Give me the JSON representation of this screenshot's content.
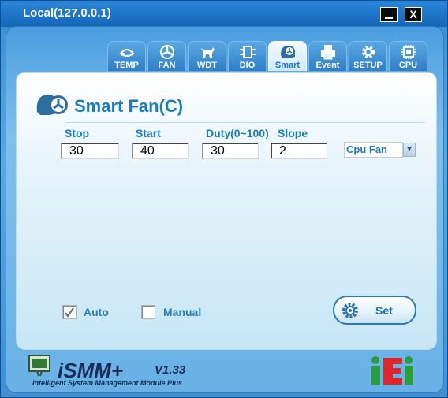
{
  "window": {
    "title": "Local(127.0.0.1)",
    "minimize_icon": "minimize-icon",
    "close_label": "X"
  },
  "tabs": [
    {
      "label": "TEMP",
      "icon": "thermometer-icon"
    },
    {
      "label": "FAN",
      "icon": "fan-icon"
    },
    {
      "label": "WDT",
      "icon": "watchdog-icon"
    },
    {
      "label": "DIO",
      "icon": "dio-icon"
    },
    {
      "label": "Smart",
      "icon": "smart-fan-icon",
      "active": true
    },
    {
      "label": "Event",
      "icon": "printer-icon"
    },
    {
      "label": "SETUP",
      "icon": "gear-icon"
    },
    {
      "label": "CPU",
      "icon": "chip-icon"
    }
  ],
  "panel": {
    "title": "Smart Fan(C)",
    "fields": {
      "stop": {
        "label": "Stop",
        "value": "30"
      },
      "start": {
        "label": "Start",
        "value": "40"
      },
      "duty": {
        "label": "Duty(0~100)",
        "value": "30"
      },
      "slope": {
        "label": "Slope",
        "value": "2"
      }
    },
    "fan_select": {
      "value": "Cpu Fan"
    },
    "modes": {
      "auto": {
        "label": "Auto",
        "checked": true
      },
      "manual": {
        "label": "Manual",
        "checked": false
      }
    },
    "set_button": {
      "label": "Set"
    }
  },
  "footer": {
    "product_wordmark": "iSMM+",
    "version": "V1.33",
    "subtitle": "Intelligent System Management Module Plus",
    "brand": "iEi"
  },
  "colors": {
    "accent": "#1a7cbf",
    "window_blue": "#2d7fc4",
    "panel_bg": "#e6f4fb"
  }
}
